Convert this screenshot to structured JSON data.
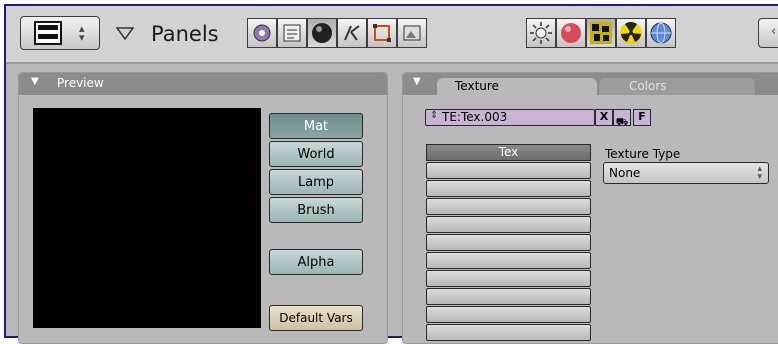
{
  "header": {
    "panels_label": "Panels",
    "context_icons": [
      "logic-icon",
      "script-icon",
      "shading-icon",
      "object-icon",
      "editing-icon",
      "scene-icon"
    ],
    "subcontext_icons": [
      "lamp-icon",
      "material-icon",
      "texture-icon",
      "radiosity-icon",
      "world-icon"
    ]
  },
  "preview_panel": {
    "title": "Preview",
    "buttons": [
      "Mat",
      "World",
      "Lamp",
      "Brush"
    ],
    "active_button": "Mat",
    "alpha_label": "Alpha",
    "default_vars_label": "Default Vars"
  },
  "texture_panel": {
    "tabs": [
      "Texture",
      "Colors"
    ],
    "active_tab": "Texture",
    "texture_name": "TE:Tex.003",
    "x_label": "X",
    "f_label": "F",
    "list_header": "Tex",
    "texture_type_label": "Texture Type",
    "texture_type_value": "None"
  },
  "colors": {
    "frame_border": "#1a1a8c",
    "active_button": "#6e8c8c",
    "name_field": "#c8b4d2"
  }
}
